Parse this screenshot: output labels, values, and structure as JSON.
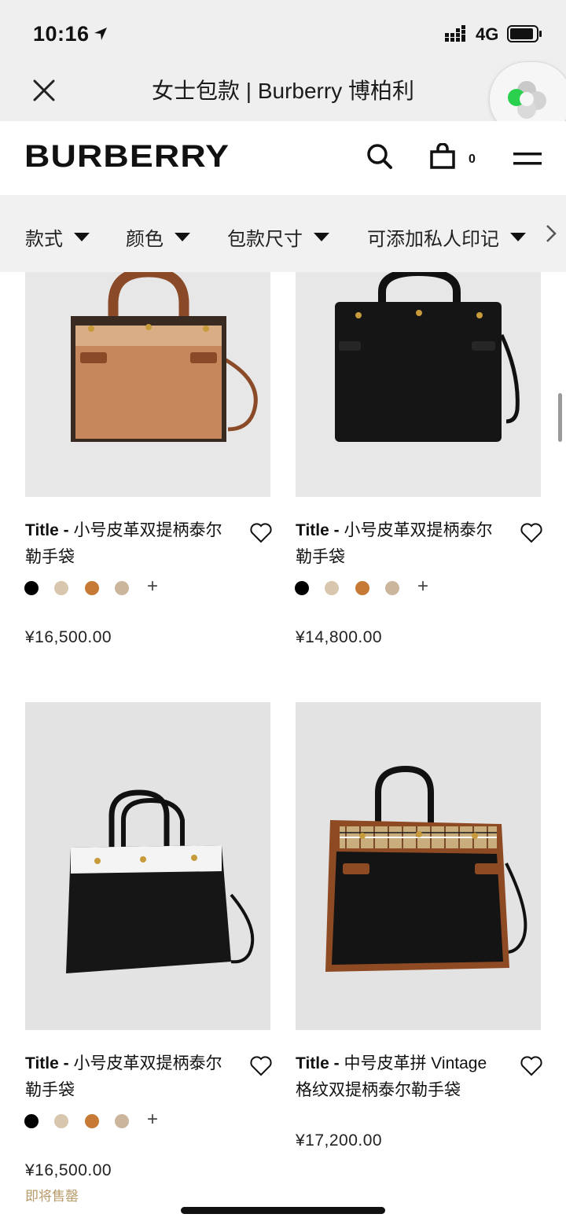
{
  "status_bar": {
    "time": "10:16",
    "network": "4G"
  },
  "wechat_bar": {
    "title": "女士包款 | Burberry 博柏利"
  },
  "header": {
    "logo": "BURBERRY",
    "cart_count": "0"
  },
  "filters": [
    {
      "label": "款式"
    },
    {
      "label": "颜色"
    },
    {
      "label": "包款尺寸"
    },
    {
      "label": "可添加私人印记"
    }
  ],
  "products": [
    {
      "title_prefix": "Title - ",
      "title_rest": "小号皮革双提柄泰尔勒手袋",
      "price": "¥16,500.00",
      "swatches": [
        "#000000",
        "#d8c6ae",
        "#c77a35",
        "#cbb59d"
      ],
      "more": "+"
    },
    {
      "title_prefix": "Title - ",
      "title_rest": "小号皮革双提柄泰尔勒手袋",
      "price": "¥14,800.00",
      "swatches": [
        "#000000",
        "#d8c6ae",
        "#c77a35",
        "#cbb59d"
      ],
      "more": "+"
    },
    {
      "title_prefix": "Title - ",
      "title_rest": "小号皮革双提柄泰尔勒手袋",
      "price": "¥16,500.00",
      "swatches": [
        "#000000",
        "#d8c6ae",
        "#c77a35",
        "#cbb59d"
      ],
      "more": "+",
      "note": "即将售罄"
    },
    {
      "title_prefix": "Title - ",
      "title_rest": "中号皮革拼 Vintage 格纹双提柄泰尔勒手袋",
      "price": "¥17,200.00"
    }
  ]
}
